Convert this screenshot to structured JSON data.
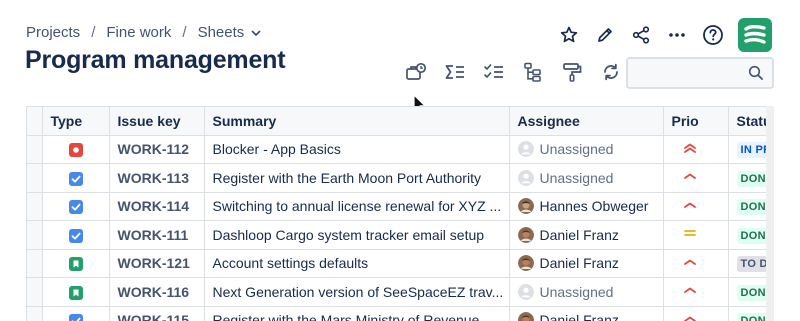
{
  "breadcrumbs": [
    {
      "label": "Projects"
    },
    {
      "label": "Fine work"
    },
    {
      "label": "Sheets"
    }
  ],
  "page_title": "Program management",
  "top_actions": [
    "star-icon",
    "edit-pencil-icon",
    "share-icon",
    "more-icon",
    "help-icon"
  ],
  "toolbar": [
    "briefcase-clock-icon",
    "sum-list-icon",
    "checklist-icon",
    "hierarchy-icon",
    "paint-roller-icon",
    "refresh-icon"
  ],
  "search": {
    "placeholder": "",
    "value": ""
  },
  "columns": [
    "Type",
    "Issue key",
    "Summary",
    "Assignee",
    "Prio",
    "Status"
  ],
  "rows": [
    {
      "type": "blocker",
      "key": "WORK-112",
      "summary": "Blocker - App Basics",
      "assignee": "Unassigned",
      "prio": "highest",
      "status": "IN PROGRESS"
    },
    {
      "type": "task",
      "key": "WORK-113",
      "summary": "Register with the Earth Moon Port Authority",
      "assignee": "Unassigned",
      "prio": "high",
      "status": "DONE"
    },
    {
      "type": "task",
      "key": "WORK-114",
      "summary": "Switching to annual license renewal for XYZ ...",
      "assignee": "Hannes Obweger",
      "prio": "high",
      "status": "DONE"
    },
    {
      "type": "task",
      "key": "WORK-111",
      "summary": "Dashloop Cargo system tracker email setup",
      "assignee": "Daniel Franz",
      "prio": "medium",
      "status": "DONE"
    },
    {
      "type": "story",
      "key": "WORK-121",
      "summary": "Account settings defaults",
      "assignee": "Daniel Franz",
      "prio": "high",
      "status": "TO DO"
    },
    {
      "type": "story",
      "key": "WORK-116",
      "summary": "Next Generation version of SeeSpaceEZ trav...",
      "assignee": "Unassigned",
      "prio": "high",
      "status": "DONE"
    },
    {
      "type": "task",
      "key": "WORK-115",
      "summary": "Register with the Mars Ministry of Revenue",
      "assignee": "Daniel Franz",
      "prio": "high",
      "status": "DONE"
    }
  ],
  "colors": {
    "blocker": "#e2483d",
    "task": "#4688ec",
    "story": "#22a06b",
    "prio_high": "#e2483d",
    "prio_medium": "#e2b203",
    "done_bg": "#dcfff1",
    "done_fg": "#216e4e",
    "inprogress_bg": "#e9f2ff",
    "inprogress_fg": "#0055cc",
    "todo_bg": "#dfe1e6",
    "todo_fg": "#44546f"
  }
}
